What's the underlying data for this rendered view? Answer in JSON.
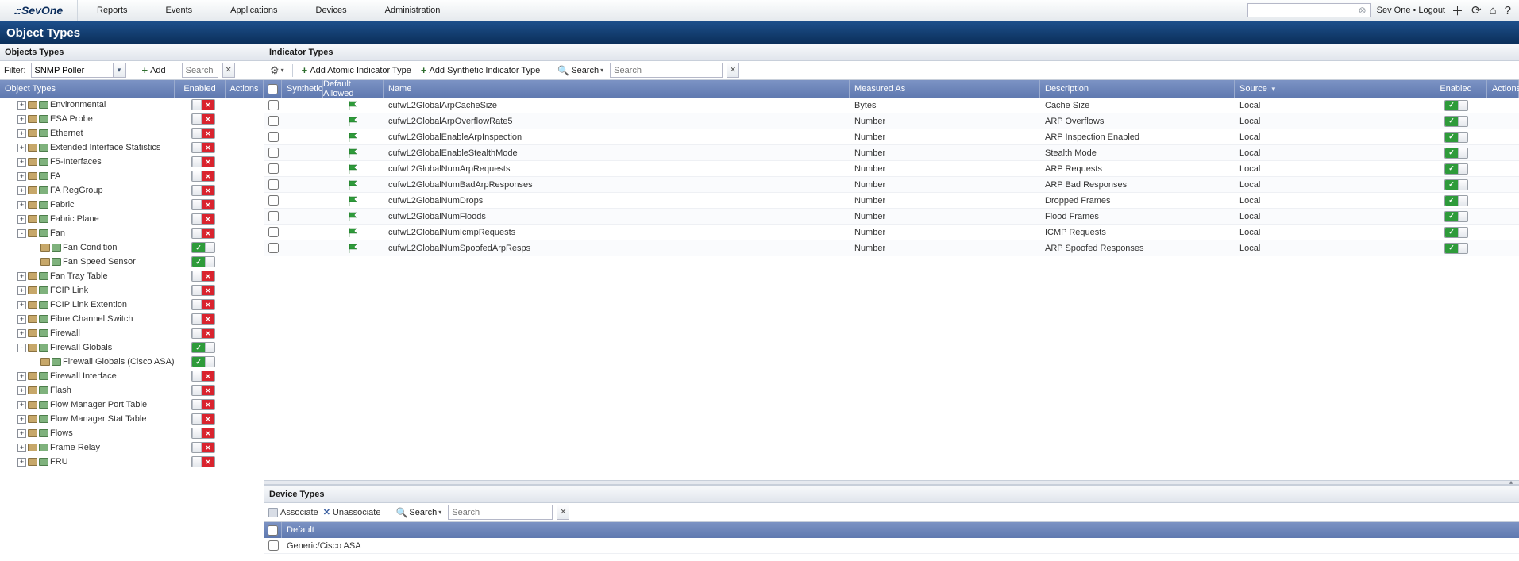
{
  "top": {
    "logo": "SevOne",
    "menu": [
      "Reports",
      "Events",
      "Applications",
      "Devices",
      "Administration"
    ],
    "search_placeholder": "",
    "user": "Sev One",
    "logout": "Logout"
  },
  "pageTitle": "Object Types",
  "left": {
    "panelTitle": "Objects Types",
    "filterLabel": "Filter:",
    "filterValue": "SNMP Poller",
    "addLabel": "Add",
    "search_placeholder": "Search",
    "headers": {
      "name": "Object Types",
      "enabled": "Enabled",
      "actions": "Actions"
    },
    "tree": [
      {
        "label": "Environmental",
        "depth": 1,
        "exp": "+",
        "enabled": false
      },
      {
        "label": "ESA Probe",
        "depth": 1,
        "exp": "+",
        "enabled": false
      },
      {
        "label": "Ethernet",
        "depth": 1,
        "exp": "+",
        "enabled": false
      },
      {
        "label": "Extended Interface Statistics",
        "depth": 1,
        "exp": "+",
        "enabled": false
      },
      {
        "label": "F5-Interfaces",
        "depth": 1,
        "exp": "+",
        "enabled": false
      },
      {
        "label": "FA",
        "depth": 1,
        "exp": "+",
        "enabled": false
      },
      {
        "label": "FA RegGroup",
        "depth": 1,
        "exp": "+",
        "enabled": false
      },
      {
        "label": "Fabric",
        "depth": 1,
        "exp": "+",
        "enabled": false
      },
      {
        "label": "Fabric Plane",
        "depth": 1,
        "exp": "+",
        "enabled": false
      },
      {
        "label": "Fan",
        "depth": 1,
        "exp": "-",
        "enabled": false
      },
      {
        "label": "Fan Condition",
        "depth": 2,
        "exp": "",
        "enabled": true
      },
      {
        "label": "Fan Speed Sensor",
        "depth": 2,
        "exp": "",
        "enabled": true
      },
      {
        "label": "Fan Tray Table",
        "depth": 1,
        "exp": "+",
        "enabled": false
      },
      {
        "label": "FCIP Link",
        "depth": 1,
        "exp": "+",
        "enabled": false
      },
      {
        "label": "FCIP Link Extention",
        "depth": 1,
        "exp": "+",
        "enabled": false
      },
      {
        "label": "Fibre Channel Switch",
        "depth": 1,
        "exp": "+",
        "enabled": false
      },
      {
        "label": "Firewall",
        "depth": 1,
        "exp": "+",
        "enabled": false
      },
      {
        "label": "Firewall Globals",
        "depth": 1,
        "exp": "-",
        "enabled": true
      },
      {
        "label": "Firewall Globals (Cisco ASA)",
        "depth": 2,
        "exp": "",
        "enabled": true
      },
      {
        "label": "Firewall Interface",
        "depth": 1,
        "exp": "+",
        "enabled": false
      },
      {
        "label": "Flash",
        "depth": 1,
        "exp": "+",
        "enabled": false
      },
      {
        "label": "Flow Manager Port Table",
        "depth": 1,
        "exp": "+",
        "enabled": false
      },
      {
        "label": "Flow Manager Stat Table",
        "depth": 1,
        "exp": "+",
        "enabled": false
      },
      {
        "label": "Flows",
        "depth": 1,
        "exp": "+",
        "enabled": false
      },
      {
        "label": "Frame Relay",
        "depth": 1,
        "exp": "+",
        "enabled": false
      },
      {
        "label": "FRU",
        "depth": 1,
        "exp": "+",
        "enabled": false
      }
    ]
  },
  "right": {
    "panelTitle": "Indicator Types",
    "toolbar": {
      "addAtomic": "Add Atomic Indicator Type",
      "addSynthetic": "Add Synthetic Indicator Type",
      "searchLabel": "Search",
      "search_placeholder": "Search"
    },
    "headers": {
      "synthetic": "Synthetic",
      "default": "Default Allowed",
      "name": "Name",
      "measured": "Measured As",
      "description": "Description",
      "source": "Source",
      "enabled": "Enabled",
      "actions": "Actions"
    },
    "rows": [
      {
        "name": "cufwL2GlobalArpCacheSize",
        "measured": "Bytes",
        "desc": "Cache Size",
        "source": "Local",
        "enabled": true
      },
      {
        "name": "cufwL2GlobalArpOverflowRate5",
        "measured": "Number",
        "desc": "ARP Overflows",
        "source": "Local",
        "enabled": true
      },
      {
        "name": "cufwL2GlobalEnableArpInspection",
        "measured": "Number",
        "desc": "ARP Inspection Enabled",
        "source": "Local",
        "enabled": true
      },
      {
        "name": "cufwL2GlobalEnableStealthMode",
        "measured": "Number",
        "desc": "Stealth Mode",
        "source": "Local",
        "enabled": true
      },
      {
        "name": "cufwL2GlobalNumArpRequests",
        "measured": "Number",
        "desc": "ARP Requests",
        "source": "Local",
        "enabled": true
      },
      {
        "name": "cufwL2GlobalNumBadArpResponses",
        "measured": "Number",
        "desc": "ARP Bad Responses",
        "source": "Local",
        "enabled": true
      },
      {
        "name": "cufwL2GlobalNumDrops",
        "measured": "Number",
        "desc": "Dropped Frames",
        "source": "Local",
        "enabled": true
      },
      {
        "name": "cufwL2GlobalNumFloods",
        "measured": "Number",
        "desc": "Flood Frames",
        "source": "Local",
        "enabled": true
      },
      {
        "name": "cufwL2GlobalNumIcmpRequests",
        "measured": "Number",
        "desc": "ICMP Requests",
        "source": "Local",
        "enabled": true
      },
      {
        "name": "cufwL2GlobalNumSpoofedArpResps",
        "measured": "Number",
        "desc": "ARP Spoofed Responses",
        "source": "Local",
        "enabled": true
      }
    ]
  },
  "dev": {
    "panelTitle": "Device Types",
    "associate": "Associate",
    "unassociate": "Unassociate",
    "searchLabel": "Search",
    "search_placeholder": "Search",
    "header": "Default",
    "rows": [
      {
        "name": "Generic/Cisco ASA"
      }
    ]
  }
}
